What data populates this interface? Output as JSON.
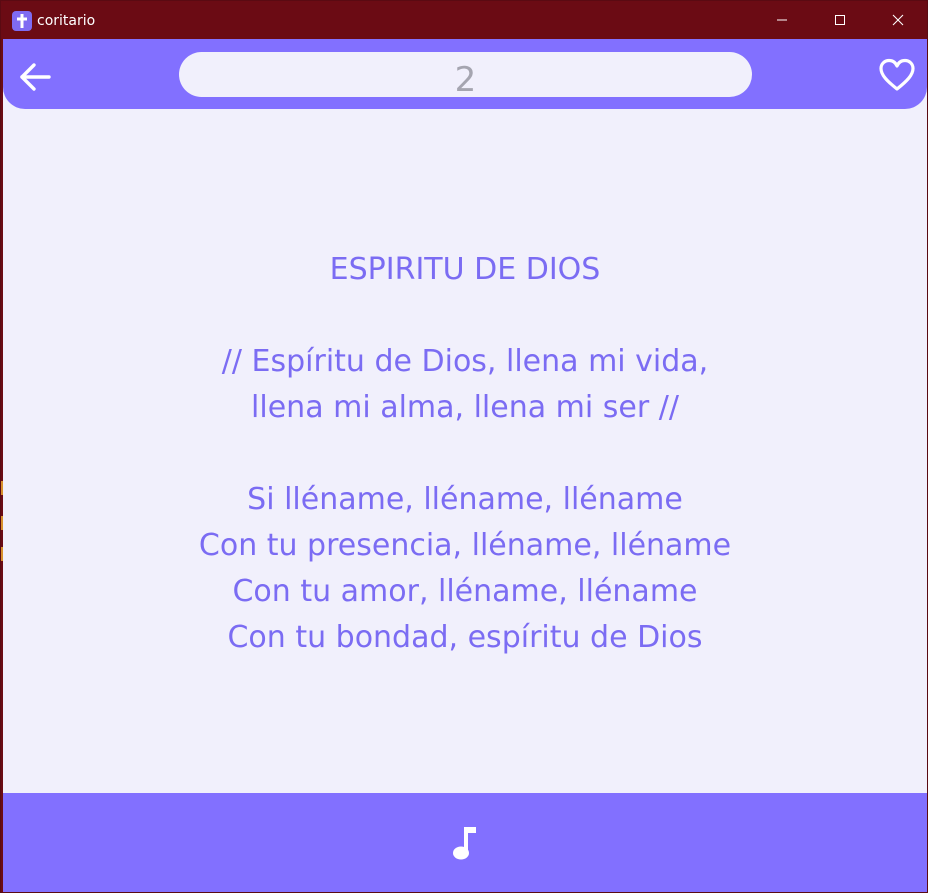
{
  "window": {
    "title": "coritario",
    "controls": {
      "minimize_icon": "minimize-icon",
      "maximize_icon": "maximize-icon",
      "close_icon": "close-icon"
    }
  },
  "appbar": {
    "back_icon": "arrow-left-icon",
    "search_value": "2",
    "favorite_icon": "heart-outline-icon"
  },
  "song": {
    "title": "ESPIRITU DE DIOS",
    "stanzas": [
      [
        "// Espíritu de Dios, llena mi vida,",
        "llena mi alma, llena mi ser //"
      ],
      [
        "Si lléname, lléname, lléname",
        "Con tu presencia, lléname, lléname",
        "Con tu amor, lléname, lléname",
        "Con tu bondad, espíritu de Dios"
      ]
    ]
  },
  "bottombar": {
    "music_icon": "music-note-icon"
  },
  "colors": {
    "titlebar": "#6b0b14",
    "accent": "#8270ff",
    "background": "#f1f0fc",
    "lyrics_text": "#7b6cf3",
    "search_text": "#a5a5b0"
  }
}
